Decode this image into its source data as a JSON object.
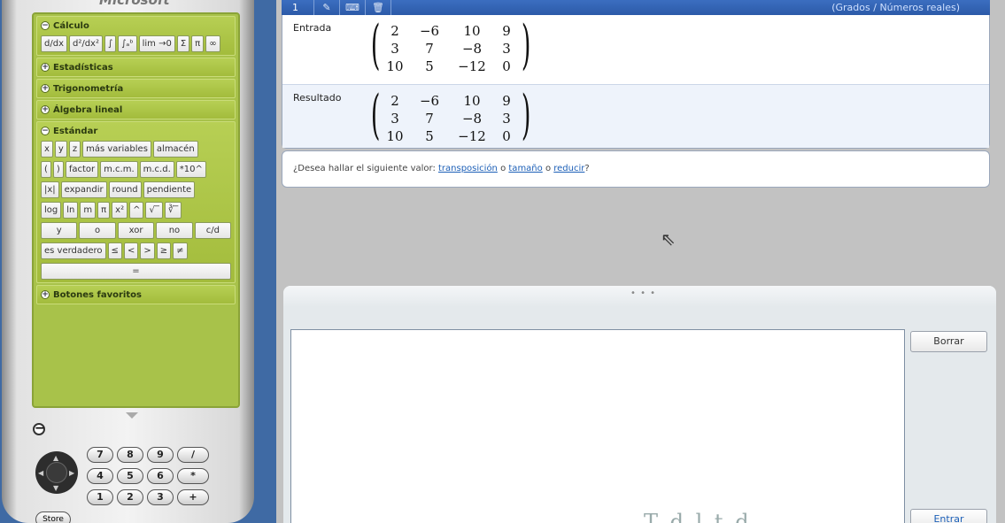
{
  "calculator": {
    "brand": "Microsoft",
    "sections": {
      "calculo": {
        "title": "Cálculo",
        "expanded_icon": "−",
        "buttons": [
          "d/dx",
          "d²/dx²",
          "∫",
          "∫ₐᵇ",
          "lim →0",
          "Σ",
          "π",
          "∞"
        ]
      },
      "estadisticas": {
        "title": "Estadísticas",
        "expanded_icon": "+"
      },
      "trigonometria": {
        "title": "Trigonometría",
        "expanded_icon": "+"
      },
      "algebra": {
        "title": "Álgebra lineal",
        "expanded_icon": "+"
      },
      "estandar": {
        "title": "Estándar",
        "expanded_icon": "−",
        "row1": [
          "x",
          "y",
          "z",
          "más variables",
          "almacén"
        ],
        "row2": [
          "(",
          ")",
          "factor",
          "m.c.m.",
          "m.c.d.",
          "*10^"
        ],
        "row3": [
          "|x|",
          "expandir",
          "round",
          "pendiente"
        ],
        "row4": [
          "log",
          "ln",
          "m",
          "π",
          "x²",
          "^",
          "√‾",
          "∛‾"
        ],
        "row5": [
          "y",
          "o",
          "xor",
          "no",
          "c/d"
        ],
        "row6": [
          "es verdadero",
          "≤",
          "<",
          ">",
          "≥",
          "≠"
        ],
        "row7": [
          "="
        ]
      },
      "favoritos": {
        "title": "Botones favoritos",
        "expanded_icon": "+"
      }
    },
    "keypad": {
      "minus": "−",
      "row1": [
        "7",
        "8",
        "9",
        "/"
      ],
      "row2": [
        "4",
        "5",
        "6",
        "*"
      ],
      "row3": [
        "1",
        "2",
        "3",
        "+"
      ],
      "store": "Store"
    }
  },
  "worksheet": {
    "toolbar": {
      "index": "1",
      "icons": [
        "edit-icon",
        "keyboard-icon",
        "trash-icon"
      ],
      "mode": "(Grados / Números reales)"
    },
    "input_label": "Entrada",
    "result_label": "Resultado",
    "input_matrix": [
      [
        "2",
        "−6",
        "10",
        "9"
      ],
      [
        "3",
        "7",
        "−8",
        "3"
      ],
      [
        "10",
        "5",
        "−12",
        "0"
      ]
    ],
    "result_matrix": [
      [
        "2",
        "−6",
        "10",
        "9"
      ],
      [
        "3",
        "7",
        "−8",
        "3"
      ],
      [
        "10",
        "5",
        "−12",
        "0"
      ]
    ],
    "suggestion": {
      "prefix": "¿Desea hallar el siguiente valor: ",
      "link1": "transposición",
      "sep1": " o ",
      "link2": "tamaño",
      "sep2": " o ",
      "link3": "reducir",
      "suffix": "?"
    }
  },
  "input_panel": {
    "handle": "• • •",
    "faded_text": "T d l t  d",
    "clear_label": "Borrar",
    "enter_label": "Entrar"
  }
}
